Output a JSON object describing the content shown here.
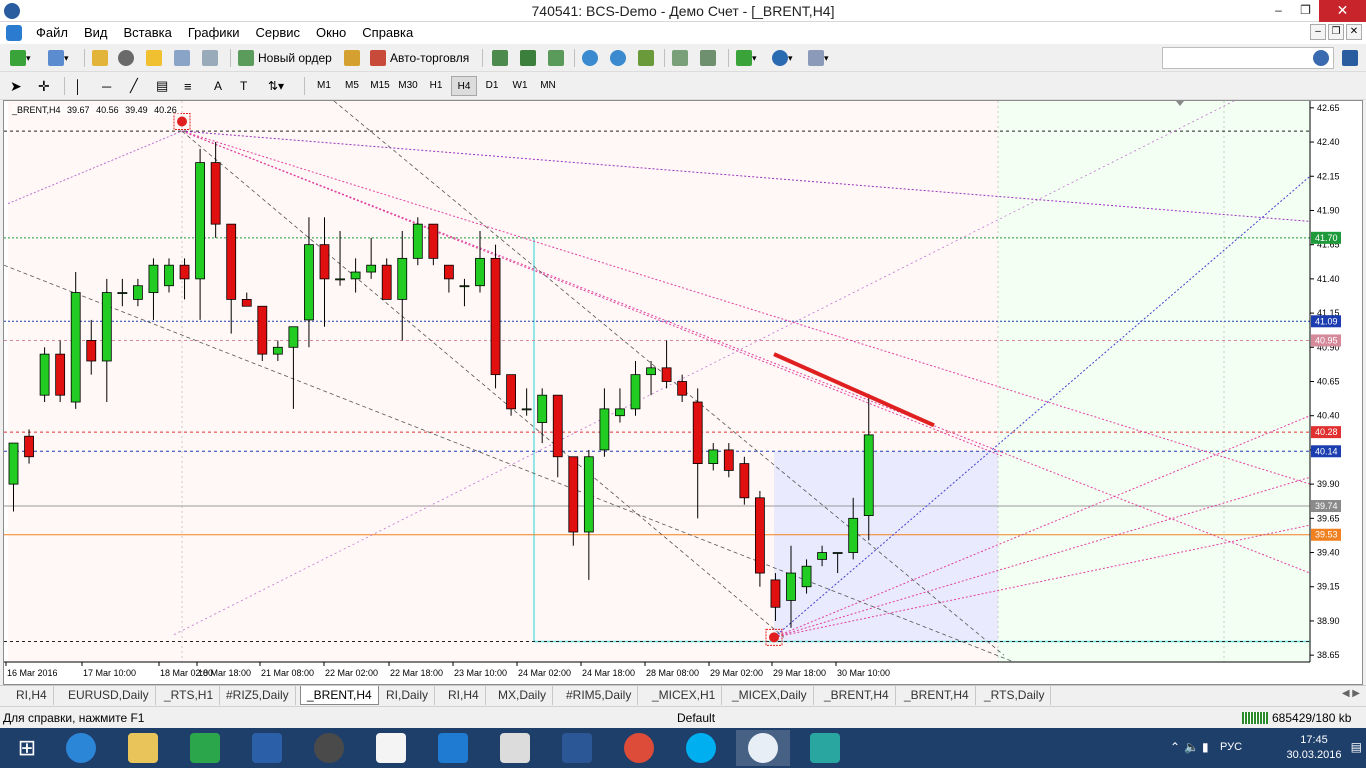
{
  "window": {
    "title": "740541: BCS-Demo - Демо Счет - [_BRENT,H4]",
    "minimize": "–",
    "restore": "❐",
    "close": "✕"
  },
  "menu": {
    "items": [
      "Файл",
      "Вид",
      "Вставка",
      "Графики",
      "Сервис",
      "Окно",
      "Справка"
    ]
  },
  "toolbar": {
    "new_order": "Новый ордер",
    "auto_trading": "Авто-торговля",
    "search_placeholder": ""
  },
  "timeframes": [
    "M1",
    "M5",
    "M15",
    "M30",
    "H1",
    "H4",
    "D1",
    "W1",
    "MN"
  ],
  "active_timeframe": "H4",
  "chart_info": {
    "symbol": "_BRENT,H4",
    "open": "39.67",
    "high": "40.56",
    "low": "39.49",
    "close": "40.26"
  },
  "chart_data": {
    "type": "candlestick",
    "y_ticks": [
      "42.65",
      "42.40",
      "42.15",
      "41.90",
      "41.65",
      "41.40",
      "41.15",
      "40.90",
      "40.65",
      "40.40",
      "40.15",
      "39.90",
      "39.65",
      "39.40",
      "39.15",
      "38.90",
      "38.65"
    ],
    "ylim": [
      38.6,
      42.7
    ],
    "x_ticks": [
      "16 Mar 2016",
      "17 Mar 10:00",
      "18 Mar 02:00",
      "18 Mar 18:00",
      "21 Mar 08:00",
      "22 Mar 02:00",
      "22 Mar 18:00",
      "23 Mar 10:00",
      "24 Mar 02:00",
      "24 Mar 18:00",
      "28 Mar 08:00",
      "29 Mar 02:00",
      "29 Mar 18:00",
      "30 Mar 10:00"
    ],
    "price_labels": [
      {
        "value": 41.7,
        "text": "41.70",
        "color": "#1f9a3a"
      },
      {
        "value": 41.09,
        "text": "41.09",
        "color": "#1c3db0"
      },
      {
        "value": 40.95,
        "text": "40.95",
        "color": "#d58a9c"
      },
      {
        "value": 40.28,
        "text": "40.28",
        "color": "#e03030"
      },
      {
        "value": 40.14,
        "text": "40.14",
        "color": "#1c3db0"
      },
      {
        "value": 39.74,
        "text": "39.74",
        "color": "#8a8a8a"
      },
      {
        "value": 39.53,
        "text": "39.53",
        "color": "#f08020"
      }
    ],
    "candles": [
      {
        "o": 39.9,
        "h": 40.1,
        "l": 39.7,
        "c": 40.2
      },
      {
        "o": 40.25,
        "h": 40.3,
        "l": 40.05,
        "c": 40.1
      },
      {
        "o": 40.55,
        "h": 40.9,
        "l": 40.5,
        "c": 40.85
      },
      {
        "o": 40.85,
        "h": 40.95,
        "l": 40.5,
        "c": 40.55
      },
      {
        "o": 40.5,
        "h": 41.45,
        "l": 40.45,
        "c": 41.3
      },
      {
        "o": 40.95,
        "h": 41.1,
        "l": 40.7,
        "c": 40.8
      },
      {
        "o": 40.8,
        "h": 41.4,
        "l": 40.5,
        "c": 41.3
      },
      {
        "o": 41.3,
        "h": 41.4,
        "l": 41.2,
        "c": 41.3
      },
      {
        "o": 41.25,
        "h": 41.4,
        "l": 41.2,
        "c": 41.35
      },
      {
        "o": 41.3,
        "h": 41.55,
        "l": 41.1,
        "c": 41.5
      },
      {
        "o": 41.35,
        "h": 41.55,
        "l": 41.3,
        "c": 41.5
      },
      {
        "o": 41.5,
        "h": 41.55,
        "l": 41.25,
        "c": 41.4
      },
      {
        "o": 41.4,
        "h": 42.35,
        "l": 41.1,
        "c": 42.25
      },
      {
        "o": 42.25,
        "h": 42.4,
        "l": 41.7,
        "c": 41.8
      },
      {
        "o": 41.8,
        "h": 41.8,
        "l": 41.0,
        "c": 41.25
      },
      {
        "o": 41.25,
        "h": 41.3,
        "l": 41.2,
        "c": 41.2
      },
      {
        "o": 41.2,
        "h": 41.2,
        "l": 40.8,
        "c": 40.85
      },
      {
        "o": 40.85,
        "h": 40.95,
        "l": 40.8,
        "c": 40.9
      },
      {
        "o": 40.9,
        "h": 41.05,
        "l": 40.45,
        "c": 41.05
      },
      {
        "o": 41.1,
        "h": 41.85,
        "l": 40.9,
        "c": 41.65
      },
      {
        "o": 41.65,
        "h": 41.85,
        "l": 41.05,
        "c": 41.4
      },
      {
        "o": 41.4,
        "h": 41.75,
        "l": 41.35,
        "c": 41.4
      },
      {
        "o": 41.4,
        "h": 41.55,
        "l": 41.3,
        "c": 41.45
      },
      {
        "o": 41.45,
        "h": 41.7,
        "l": 41.4,
        "c": 41.5
      },
      {
        "o": 41.5,
        "h": 41.55,
        "l": 41.25,
        "c": 41.25
      },
      {
        "o": 41.25,
        "h": 41.75,
        "l": 40.95,
        "c": 41.55
      },
      {
        "o": 41.55,
        "h": 41.85,
        "l": 41.5,
        "c": 41.8
      },
      {
        "o": 41.8,
        "h": 41.8,
        "l": 41.5,
        "c": 41.55
      },
      {
        "o": 41.5,
        "h": 41.5,
        "l": 41.3,
        "c": 41.4
      },
      {
        "o": 41.35,
        "h": 41.4,
        "l": 41.2,
        "c": 41.35
      },
      {
        "o": 41.35,
        "h": 41.75,
        "l": 41.3,
        "c": 41.55
      },
      {
        "o": 41.55,
        "h": 41.65,
        "l": 40.6,
        "c": 40.7
      },
      {
        "o": 40.7,
        "h": 40.7,
        "l": 40.4,
        "c": 40.45
      },
      {
        "o": 40.45,
        "h": 40.6,
        "l": 40.4,
        "c": 40.45
      },
      {
        "o": 40.35,
        "h": 40.6,
        "l": 40.2,
        "c": 40.55
      },
      {
        "o": 40.55,
        "h": 40.55,
        "l": 39.95,
        "c": 40.1
      },
      {
        "o": 40.1,
        "h": 40.1,
        "l": 39.45,
        "c": 39.55
      },
      {
        "o": 39.55,
        "h": 40.15,
        "l": 39.2,
        "c": 40.1
      },
      {
        "o": 40.15,
        "h": 40.6,
        "l": 40.1,
        "c": 40.45
      },
      {
        "o": 40.4,
        "h": 40.6,
        "l": 40.35,
        "c": 40.45
      },
      {
        "o": 40.45,
        "h": 40.8,
        "l": 40.4,
        "c": 40.7
      },
      {
        "o": 40.7,
        "h": 40.8,
        "l": 40.55,
        "c": 40.75
      },
      {
        "o": 40.75,
        "h": 40.95,
        "l": 40.6,
        "c": 40.65
      },
      {
        "o": 40.65,
        "h": 40.7,
        "l": 40.5,
        "c": 40.55
      },
      {
        "o": 40.5,
        "h": 40.6,
        "l": 39.65,
        "c": 40.05
      },
      {
        "o": 40.05,
        "h": 40.2,
        "l": 40.0,
        "c": 40.15
      },
      {
        "o": 40.15,
        "h": 40.2,
        "l": 39.95,
        "c": 40.0
      },
      {
        "o": 40.05,
        "h": 40.1,
        "l": 39.75,
        "c": 39.8
      },
      {
        "o": 39.8,
        "h": 39.85,
        "l": 39.15,
        "c": 39.25
      },
      {
        "o": 39.2,
        "h": 39.25,
        "l": 38.9,
        "c": 39.0
      },
      {
        "o": 39.05,
        "h": 39.45,
        "l": 38.85,
        "c": 39.25
      },
      {
        "o": 39.15,
        "h": 39.35,
        "l": 39.1,
        "c": 39.3
      },
      {
        "o": 39.35,
        "h": 39.45,
        "l": 39.3,
        "c": 39.4
      },
      {
        "o": 39.4,
        "h": 39.4,
        "l": 39.25,
        "c": 39.4
      },
      {
        "o": 39.4,
        "h": 39.8,
        "l": 39.35,
        "c": 39.65
      },
      {
        "o": 39.67,
        "h": 40.56,
        "l": 39.49,
        "c": 40.26
      }
    ]
  },
  "chart_tabs": [
    "RI,H4",
    "EURUSD,Daily",
    "_RTS,H1",
    "#RIZ5,Daily",
    "_BRENT,H4",
    "RI,Daily",
    "RI,H4",
    "MX,Daily",
    "#RIM5,Daily",
    "_MICEX,H1",
    "_MICEX,Daily",
    "_BRENT,H4",
    "_BRENT,H4",
    "_RTS,Daily"
  ],
  "active_tab": 4,
  "status": {
    "help": "Для справки, нажмите F1",
    "profile": "Default",
    "connection": "685429/180 kb"
  },
  "tray": {
    "lang": "РУС",
    "time": "17:45",
    "date": "30.03.2016"
  },
  "colors": {
    "bull": "#22cc22",
    "bear": "#e01010",
    "grid": "#c8c8c8"
  }
}
